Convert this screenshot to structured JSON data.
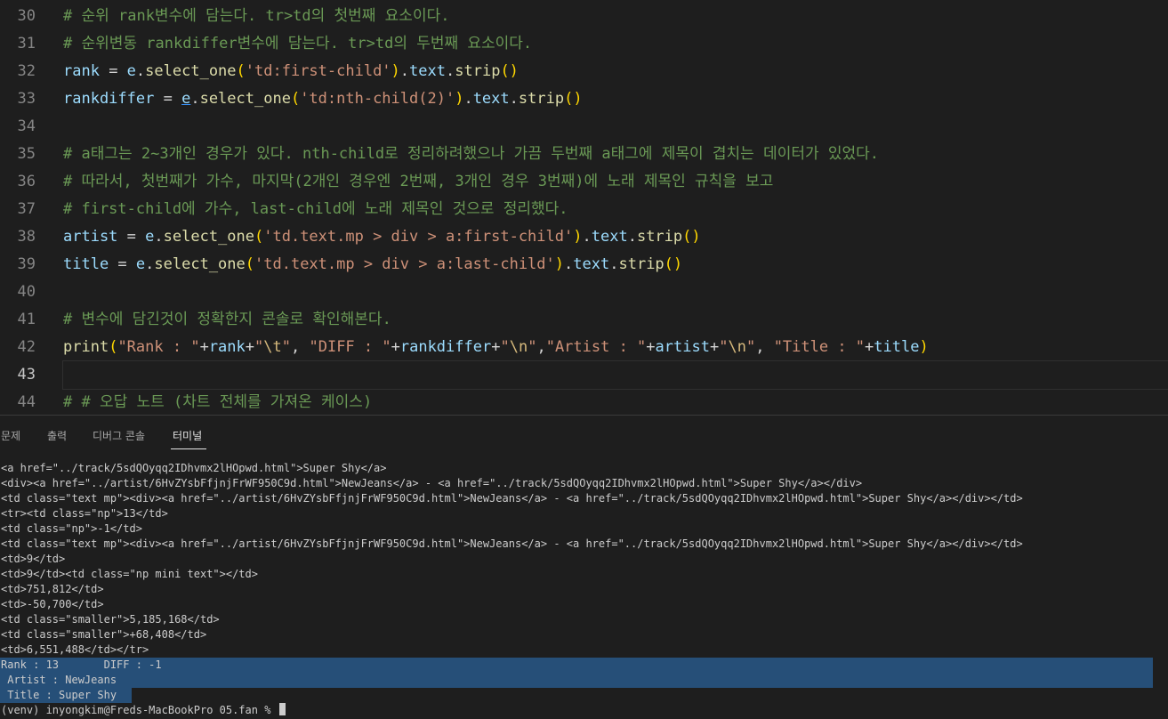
{
  "editor": {
    "lines": [
      {
        "num": "30",
        "tokens": [
          {
            "t": "# 순위 rank변수에 담는다. tr>td의 첫번째 요소이다.",
            "c": "c-com"
          }
        ]
      },
      {
        "num": "31",
        "tokens": [
          {
            "t": "# 순위변동 rankdiffer변수에 담는다. tr>td의 두번째 요소이다.",
            "c": "c-com"
          }
        ]
      },
      {
        "num": "32",
        "tokens": [
          {
            "t": "rank",
            "c": "c-var"
          },
          {
            "t": " = ",
            "c": "c-op"
          },
          {
            "t": "e",
            "c": "c-var"
          },
          {
            "t": ".",
            "c": "c-op"
          },
          {
            "t": "select_one",
            "c": "c-fn"
          },
          {
            "t": "(",
            "c": "c-br"
          },
          {
            "t": "'td:first-child'",
            "c": "c-str"
          },
          {
            "t": ")",
            "c": "c-br"
          },
          {
            "t": ".",
            "c": "c-op"
          },
          {
            "t": "text",
            "c": "c-var"
          },
          {
            "t": ".",
            "c": "c-op"
          },
          {
            "t": "strip",
            "c": "c-fn"
          },
          {
            "t": "()",
            "c": "c-br"
          }
        ]
      },
      {
        "num": "33",
        "tokens": [
          {
            "t": "rankdiffer",
            "c": "c-var"
          },
          {
            "t": " = ",
            "c": "c-op"
          },
          {
            "t": "e",
            "c": "c-var squig"
          },
          {
            "t": ".",
            "c": "c-op"
          },
          {
            "t": "select_one",
            "c": "c-fn"
          },
          {
            "t": "(",
            "c": "c-br"
          },
          {
            "t": "'td:nth-child(2)'",
            "c": "c-str"
          },
          {
            "t": ")",
            "c": "c-br"
          },
          {
            "t": ".",
            "c": "c-op"
          },
          {
            "t": "text",
            "c": "c-var"
          },
          {
            "t": ".",
            "c": "c-op"
          },
          {
            "t": "strip",
            "c": "c-fn"
          },
          {
            "t": "()",
            "c": "c-br"
          }
        ]
      },
      {
        "num": "34",
        "tokens": []
      },
      {
        "num": "35",
        "tokens": [
          {
            "t": "# a태그는 2~3개인 경우가 있다. nth-child로 정리하려했으나 가끔 두번째 a태그에 제목이 겹치는 데이터가 있었다.",
            "c": "c-com"
          }
        ]
      },
      {
        "num": "36",
        "tokens": [
          {
            "t": "# 따라서, 첫번째가 가수, 마지막(2개인 경우엔 2번째, 3개인 경우 3번째)에 노래 제목인 규칙을 보고",
            "c": "c-com"
          }
        ]
      },
      {
        "num": "37",
        "tokens": [
          {
            "t": "# first-child에 가수, last-child에 노래 제목인 것으로 정리했다.",
            "c": "c-com"
          }
        ]
      },
      {
        "num": "38",
        "tokens": [
          {
            "t": "artist",
            "c": "c-var"
          },
          {
            "t": " = ",
            "c": "c-op"
          },
          {
            "t": "e",
            "c": "c-var"
          },
          {
            "t": ".",
            "c": "c-op"
          },
          {
            "t": "select_one",
            "c": "c-fn"
          },
          {
            "t": "(",
            "c": "c-br"
          },
          {
            "t": "'td.text.mp > div > a:first-child'",
            "c": "c-str"
          },
          {
            "t": ")",
            "c": "c-br"
          },
          {
            "t": ".",
            "c": "c-op"
          },
          {
            "t": "text",
            "c": "c-var"
          },
          {
            "t": ".",
            "c": "c-op"
          },
          {
            "t": "strip",
            "c": "c-fn"
          },
          {
            "t": "()",
            "c": "c-br"
          }
        ]
      },
      {
        "num": "39",
        "tokens": [
          {
            "t": "title",
            "c": "c-var"
          },
          {
            "t": " = ",
            "c": "c-op"
          },
          {
            "t": "e",
            "c": "c-var"
          },
          {
            "t": ".",
            "c": "c-op"
          },
          {
            "t": "select_one",
            "c": "c-fn"
          },
          {
            "t": "(",
            "c": "c-br"
          },
          {
            "t": "'td.text.mp > div > a:last-child'",
            "c": "c-str"
          },
          {
            "t": ")",
            "c": "c-br"
          },
          {
            "t": ".",
            "c": "c-op"
          },
          {
            "t": "text",
            "c": "c-var"
          },
          {
            "t": ".",
            "c": "c-op"
          },
          {
            "t": "strip",
            "c": "c-fn"
          },
          {
            "t": "()",
            "c": "c-br"
          }
        ]
      },
      {
        "num": "40",
        "tokens": []
      },
      {
        "num": "41",
        "tokens": [
          {
            "t": "# 변수에 담긴것이 정확한지 콘솔로 확인해본다.",
            "c": "c-com"
          }
        ]
      },
      {
        "num": "42",
        "tokens": [
          {
            "t": "print",
            "c": "c-fn"
          },
          {
            "t": "(",
            "c": "c-br"
          },
          {
            "t": "\"Rank : \"",
            "c": "c-str"
          },
          {
            "t": "+",
            "c": "c-op"
          },
          {
            "t": "rank",
            "c": "c-var"
          },
          {
            "t": "+",
            "c": "c-op"
          },
          {
            "t": "\"",
            "c": "c-str"
          },
          {
            "t": "\\t",
            "c": "c-esc"
          },
          {
            "t": "\"",
            "c": "c-str"
          },
          {
            "t": ", ",
            "c": "c-op"
          },
          {
            "t": "\"DIFF : \"",
            "c": "c-str"
          },
          {
            "t": "+",
            "c": "c-op"
          },
          {
            "t": "rankdiffer",
            "c": "c-var"
          },
          {
            "t": "+",
            "c": "c-op"
          },
          {
            "t": "\"",
            "c": "c-str"
          },
          {
            "t": "\\n",
            "c": "c-esc"
          },
          {
            "t": "\"",
            "c": "c-str"
          },
          {
            "t": ",",
            "c": "c-op"
          },
          {
            "t": "\"Artist : \"",
            "c": "c-str"
          },
          {
            "t": "+",
            "c": "c-op"
          },
          {
            "t": "artist",
            "c": "c-var"
          },
          {
            "t": "+",
            "c": "c-op"
          },
          {
            "t": "\"",
            "c": "c-str"
          },
          {
            "t": "\\n",
            "c": "c-esc"
          },
          {
            "t": "\"",
            "c": "c-str"
          },
          {
            "t": ", ",
            "c": "c-op"
          },
          {
            "t": "\"Title : \"",
            "c": "c-str"
          },
          {
            "t": "+",
            "c": "c-op"
          },
          {
            "t": "title",
            "c": "c-var"
          },
          {
            "t": ")",
            "c": "c-br"
          }
        ]
      },
      {
        "num": "43",
        "tokens": [],
        "current": true
      },
      {
        "num": "44",
        "tokens": [
          {
            "t": "# # 오답 노트 (차트 전체를 가져온 케이스)",
            "c": "c-com"
          }
        ]
      }
    ]
  },
  "panel": {
    "tabs": [
      {
        "label": "문제",
        "active": false
      },
      {
        "label": "출력",
        "active": false
      },
      {
        "label": "디버그 콘솔",
        "active": false
      },
      {
        "label": "터미널",
        "active": true
      }
    ],
    "terminal_lines": [
      "<a href=\"../track/5sdQOyqq2IDhvmx2lHOpwd.html\">Super Shy</a>",
      "<div><a href=\"../artist/6HvZYsbFfjnjFrWF950C9d.html\">NewJeans</a> - <a href=\"../track/5sdQOyqq2IDhvmx2lHOpwd.html\">Super Shy</a></div>",
      "<td class=\"text mp\"><div><a href=\"../artist/6HvZYsbFfjnjFrWF950C9d.html\">NewJeans</a> - <a href=\"../track/5sdQOyqq2IDhvmx2lHOpwd.html\">Super Shy</a></div></td>",
      "<tr><td class=\"np\">13</td>",
      "<td class=\"np\">-1</td>",
      "<td class=\"text mp\"><div><a href=\"../artist/6HvZYsbFfjnjFrWF950C9d.html\">NewJeans</a> - <a href=\"../track/5sdQOyqq2IDhvmx2lHOpwd.html\">Super Shy</a></div></td>",
      "<td>9</td>",
      "<td>9</td><td class=\"np mini text\"></td>",
      "<td>751,812</td>",
      "<td>-50,700</td>",
      "<td class=\"smaller\">5,185,168</td>",
      "<td class=\"smaller\">+68,408</td>",
      "<td>6,551,488</td></tr>",
      "Rank : 13       DIFF : -1",
      " Artist : NewJeans",
      " Title : Super Shy"
    ],
    "prompt": "(venv) inyongkim@Freds-MacBookPro 05.fan % "
  }
}
